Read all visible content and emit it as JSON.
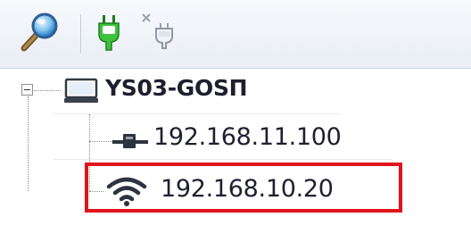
{
  "toolbar": {
    "buttons": [
      {
        "icon": "search-icon"
      },
      {
        "icon": "plug-connect-icon"
      },
      {
        "icon": "plug-disconnect-icon"
      }
    ]
  },
  "tree": {
    "root": {
      "label": "YS03-GOSП",
      "icon": "computer-icon",
      "expanded": true
    },
    "children": [
      {
        "label": "192.168.11.100",
        "icon": "ethernet-icon"
      },
      {
        "label": "192.168.10.20",
        "icon": "wifi-icon",
        "highlighted": true
      }
    ]
  },
  "colors": {
    "highlight": "#e1141b",
    "plug_green": "#2aa02a",
    "text": "#1f1f2f"
  }
}
